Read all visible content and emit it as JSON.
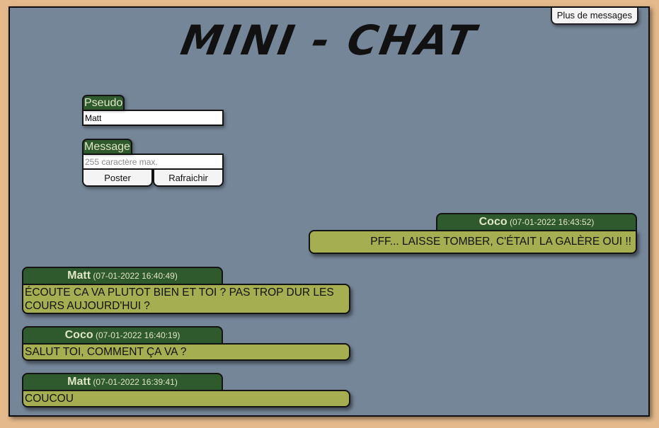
{
  "header": {
    "more_button": "Plus de messages",
    "title": "MINI - CHAT"
  },
  "form": {
    "pseudo_label": "Pseudo",
    "pseudo_value": "Matt",
    "message_label": "Message",
    "message_placeholder": "255 caractère max.",
    "post_button": "Poster",
    "refresh_button": "Rafraichir"
  },
  "messages": [
    {
      "author": "Coco",
      "timestamp": "(07-01-2022 16:43:52)",
      "text": "PFF... LAISSE TOMBER, C'ÉTAIT LA GALÈRE OUI !!",
      "side": "right"
    },
    {
      "author": "Matt",
      "timestamp": "(07-01-2022 16:40:49)",
      "text": "ÉCOUTE CA VA PLUTOT BIEN ET TOI ? PAS TROP DUR LES COURS AUJOURD'HUI ?",
      "side": "left"
    },
    {
      "author": "Coco",
      "timestamp": "(07-01-2022 16:40:19)",
      "text": "SALUT TOI, COMMENT ÇA VA ?",
      "side": "left"
    },
    {
      "author": "Matt",
      "timestamp": "(07-01-2022 16:39:41)",
      "text": "COUCOU",
      "side": "left"
    }
  ],
  "colors": {
    "page_background": "#e4b98c",
    "chat_background": "#758698",
    "header_green": "#2f5a2d",
    "bubble_olive": "#a5ae50"
  }
}
